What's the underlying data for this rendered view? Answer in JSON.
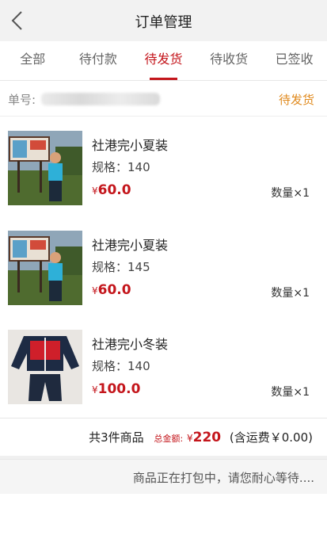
{
  "header": {
    "title": "订单管理",
    "back_icon": "chevron-left-icon"
  },
  "tabs": [
    {
      "label": "全部",
      "active": false
    },
    {
      "label": "待付款",
      "active": false
    },
    {
      "label": "待发货",
      "active": true
    },
    {
      "label": "待收货",
      "active": false
    },
    {
      "label": "已签收",
      "active": false
    }
  ],
  "order": {
    "number_label": "单号:",
    "status": "待发货"
  },
  "items": [
    {
      "name": "社港完小夏装",
      "spec": "规格：140",
      "currency": "¥",
      "price": "60.0",
      "qty": "数量×1",
      "image": "summer-uniform-photo"
    },
    {
      "name": "社港完小夏装",
      "spec": "规格：145",
      "currency": "¥",
      "price": "60.0",
      "qty": "数量×1",
      "image": "summer-uniform-photo"
    },
    {
      "name": "社港完小冬装",
      "spec": "规格：140",
      "currency": "¥",
      "price": "100.0",
      "qty": "数量×1",
      "image": "winter-uniform-photo"
    }
  ],
  "summary": {
    "count_text": "共3件商品",
    "total_label": "总金额:",
    "currency": "¥",
    "total": "220",
    "shipping_text": "(含运费￥0.00)"
  },
  "status_message": "商品正在打包中，请您耐心等待....",
  "colors": {
    "accent": "#c4161c",
    "status_orange": "#e08a1e",
    "header_bg": "#f2f2f2"
  }
}
